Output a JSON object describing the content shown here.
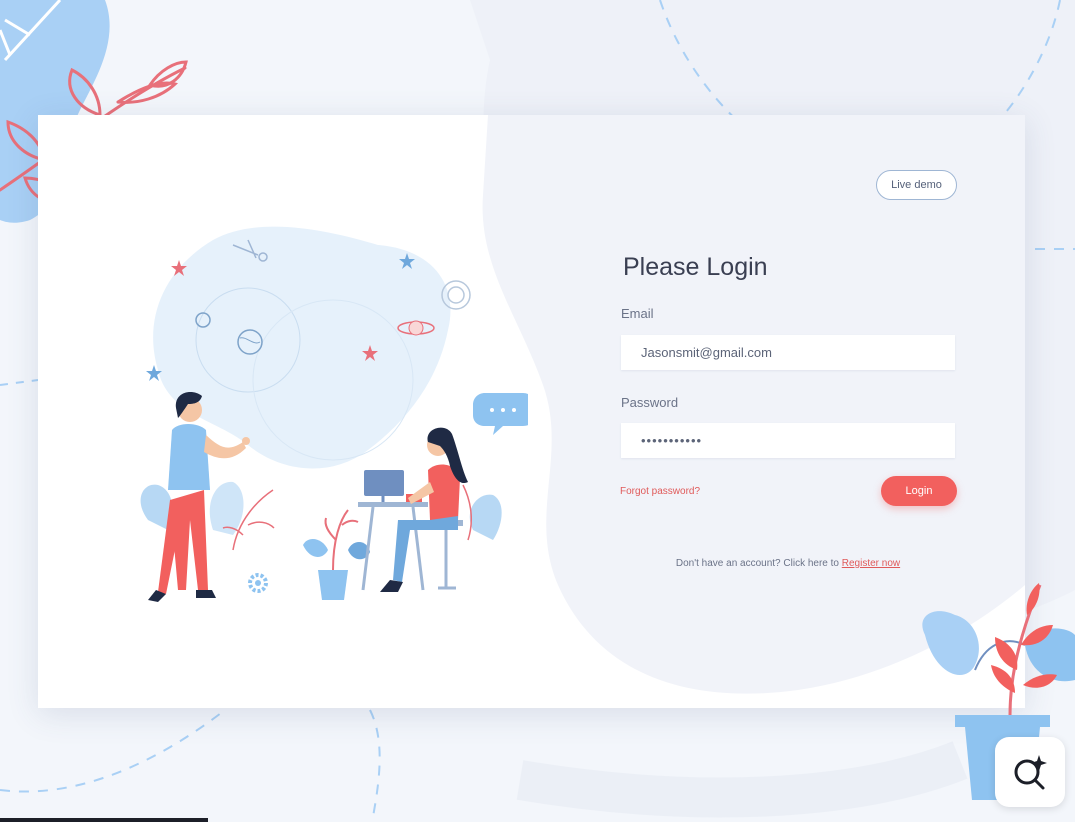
{
  "header": {
    "live_demo_label": "Live demo"
  },
  "login_form": {
    "title": "Please Login",
    "email_label": "Email",
    "email_value": "Jasonsmit@gmail.com",
    "password_label": "Password",
    "password_value": "•••••••••••",
    "forgot_password": "Forgot password?",
    "login_button": "Login"
  },
  "footer": {
    "register_prompt": "Don't have an account? Click here to ",
    "register_link": "Register now"
  },
  "icons": {
    "zoom": "zoom-sparkle-icon",
    "illustration": "people-working-illustration",
    "plant": "potted-plant-icon"
  },
  "colors": {
    "accent": "#f2605e",
    "light_blue": "#a9d0f5",
    "page_bg": "#f3f6fb",
    "card_bg": "#ffffff",
    "coral_leaf": "#e8707a"
  }
}
